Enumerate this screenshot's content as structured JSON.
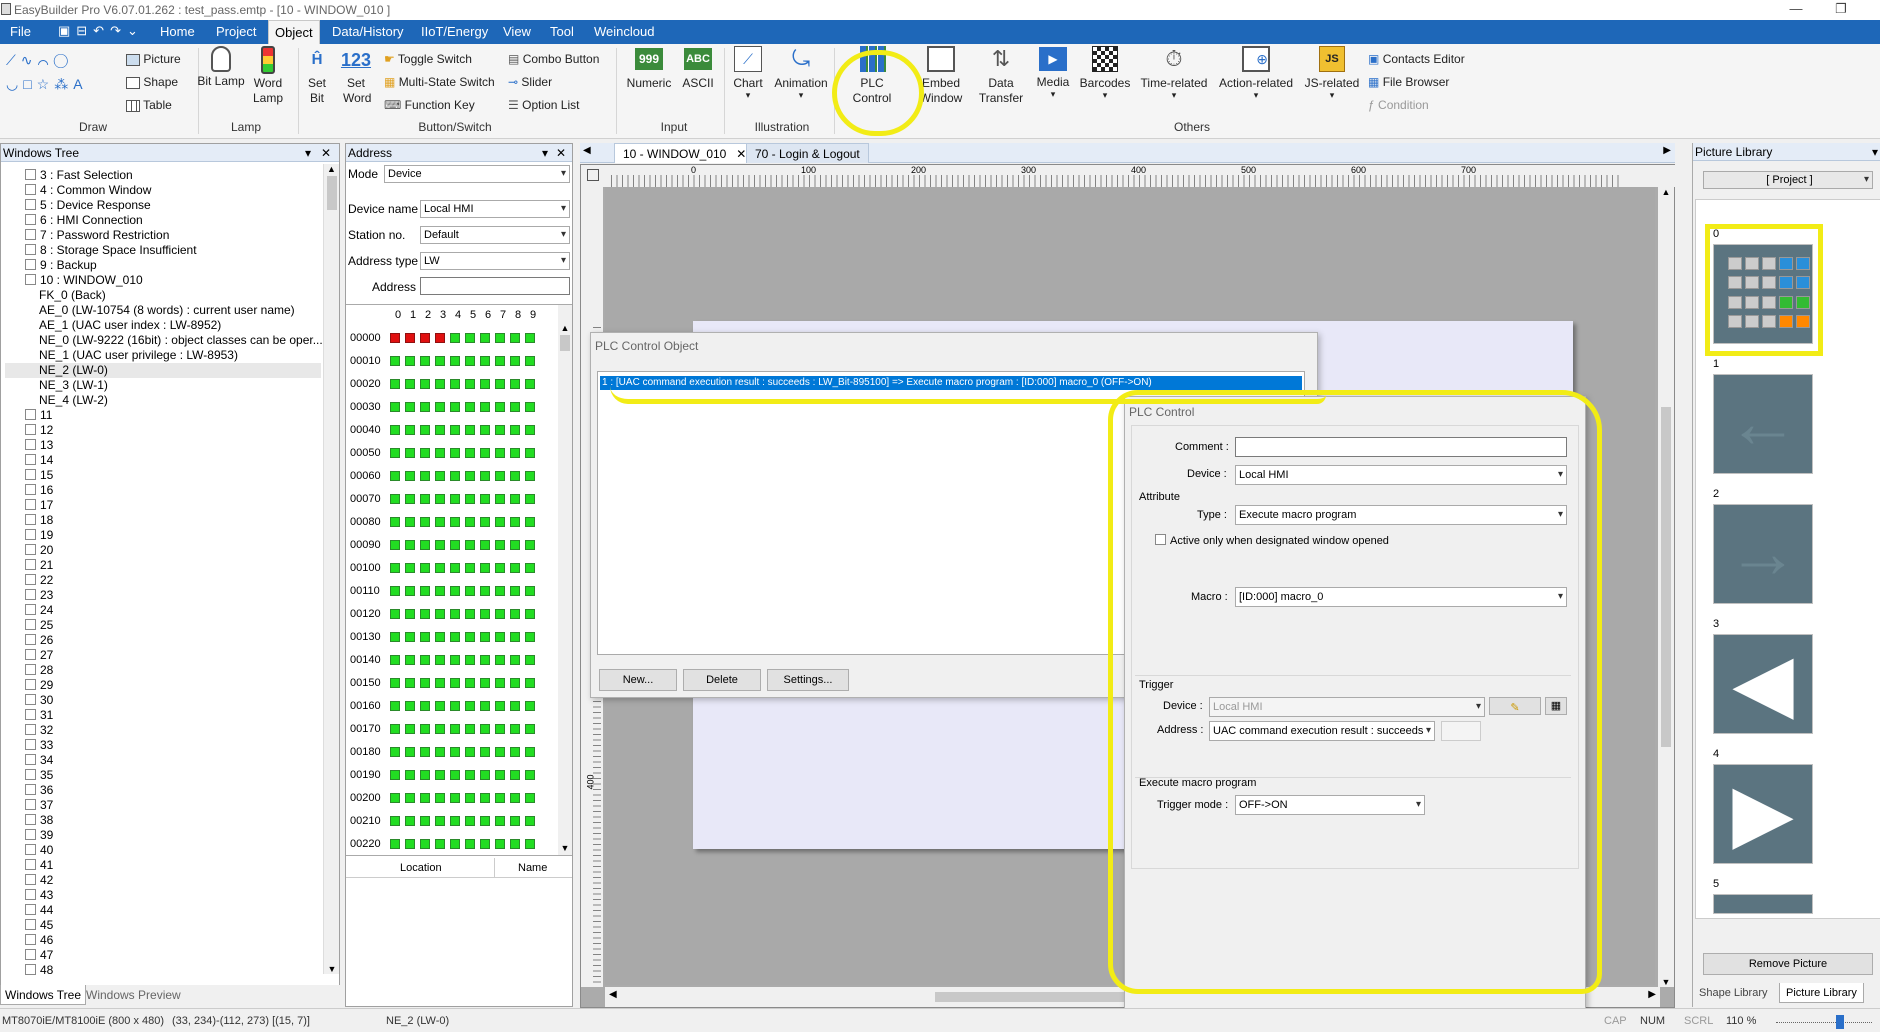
{
  "title": "EasyBuilder Pro V6.07.01.262 : test_pass.emtp - [10 - WINDOW_010 ]",
  "menu": [
    "File",
    "Home",
    "Project",
    "Object",
    "Data/History",
    "IIoT/Energy",
    "View",
    "Tool",
    "Weincloud"
  ],
  "ribbon": {
    "draw": {
      "picture": "Picture",
      "shape": "Shape",
      "table": "Table",
      "group": "Draw"
    },
    "lamp": {
      "bit": "Bit Lamp",
      "word": "Word Lamp",
      "group": "Lamp"
    },
    "button": {
      "setbit": "Set Bit",
      "setword": "Set Word",
      "toggle": "Toggle Switch",
      "multi": "Multi-State Switch",
      "fkey": "Function Key",
      "combo": "Combo Button",
      "slider": "Slider",
      "option": "Option List",
      "group": "Button/Switch"
    },
    "input": {
      "numeric": "Numeric",
      "ascii": "ASCII",
      "group": "Input",
      "icon_numeric": "999",
      "icon_ascii": "ABC"
    },
    "illus": {
      "chart": "Chart",
      "anim": "Animation",
      "group": "Illustration"
    },
    "others": {
      "plc": "PLC Control",
      "embed": "Embed Window",
      "data": "Data Transfer",
      "media": "Media",
      "barcodes": "Barcodes",
      "time": "Time-related",
      "action": "Action-related",
      "js": "JS-related",
      "contacts": "Contacts Editor",
      "file": "File Browser",
      "condition": "Condition",
      "group": "Others"
    }
  },
  "wtree": {
    "title": "Windows Tree",
    "items": [
      "3 : Fast Selection",
      "4 : Common Window",
      "5 : Device Response",
      "6 : HMI Connection",
      "7 : Password Restriction",
      "8 : Storage Space Insufficient",
      "9 : Backup",
      "10 : WINDOW_010",
      "FK_0 (Back)",
      "AE_0 (LW-10754 (8 words) : current user name)",
      "AE_1 (UAC user index : LW-8952)",
      "NE_0 (LW-9222 (16bit) : object classes can be oper...",
      "NE_1 (UAC user privilege : LW-8953)",
      "NE_2 (LW-0)",
      "NE_3 (LW-1)",
      "NE_4 (LW-2)",
      "11",
      "12",
      "13",
      "14",
      "15",
      "16",
      "17",
      "18",
      "19",
      "20",
      "21",
      "22",
      "23",
      "24",
      "25",
      "26",
      "27",
      "28",
      "29",
      "30",
      "31",
      "32",
      "33",
      "34",
      "35",
      "36",
      "37",
      "38",
      "39",
      "40",
      "41",
      "42",
      "43",
      "44",
      "45",
      "46",
      "47",
      "48"
    ],
    "tabs": [
      "Windows Tree",
      "Windows Preview"
    ]
  },
  "address": {
    "title": "Address",
    "mode_label": "Mode",
    "mode": "Device",
    "device_label": "Device name",
    "device": "Local HMI",
    "station_label": "Station no.",
    "station": "Default",
    "type_label": "Address type",
    "type": "LW",
    "addr_label": "Address",
    "cols": [
      "0",
      "1",
      "2",
      "3",
      "4",
      "5",
      "6",
      "7",
      "8",
      "9"
    ],
    "rows": [
      "00000",
      "00010",
      "00020",
      "00030",
      "00040",
      "00050",
      "00060",
      "00070",
      "00080",
      "00090",
      "00100",
      "00110",
      "00120",
      "00130",
      "00140",
      "00150",
      "00160",
      "00170",
      "00180",
      "00190",
      "00200",
      "00210",
      "00220"
    ],
    "loc_label": "Location",
    "name_label": "Name"
  },
  "doc_tabs": [
    "10 - WINDOW_010",
    "70 - Login & Logout"
  ],
  "ruler": [
    "0",
    "100",
    "200",
    "300",
    "400",
    "500",
    "600",
    "700"
  ],
  "ruler_v": [
    "400"
  ],
  "plc_obj": {
    "title": "PLC Control Object",
    "item": "1 :    [UAC command execution result : succeeds : LW_Bit-895100] => Execute macro program : [ID:000] macro_0 (OFF->ON)",
    "new": "New...",
    "delete": "Delete",
    "settings": "Settings..."
  },
  "plc": {
    "title": "PLC Control",
    "comment_label": "Comment :",
    "comment": "",
    "device_label": "Device :",
    "device": "Local HMI",
    "attribute": "Attribute",
    "type_label": "Type :",
    "type": "Execute macro program",
    "active_only": "Active only when designated window opened",
    "macro_label": "Macro :",
    "macro": "[ID:000] macro_0",
    "trigger": "Trigger",
    "t_device_label": "Device :",
    "t_device": "Local HMI",
    "t_addr_label": "Address :",
    "t_addr": "UAC command execution result : succeeds",
    "exec": "Execute macro program",
    "mode_label": "Trigger mode :",
    "mode": "OFF->ON"
  },
  "piclib": {
    "title": "Picture Library",
    "project": "[ Project ]",
    "nums": [
      "0",
      "1",
      "2",
      "3",
      "4",
      "5"
    ],
    "remove": "Remove Picture",
    "tabs": [
      "Shape Library",
      "Picture Library"
    ]
  },
  "status": {
    "model": "MT8070iE/MT8100iE (800 x 480)",
    "coords": "(33, 234)-(112, 273) [(15, 7)]",
    "obj": "NE_2 (LW-0)",
    "cap": "CAP",
    "num": "NUM",
    "scrl": "SCRL",
    "zoom": "110 %"
  },
  "colors": {
    "menubar": "#1e67b8",
    "highlight": "#f2ec16",
    "selection": "#0078d7",
    "lamp_on": "#22dd22",
    "lamp_red": "#e01010"
  }
}
